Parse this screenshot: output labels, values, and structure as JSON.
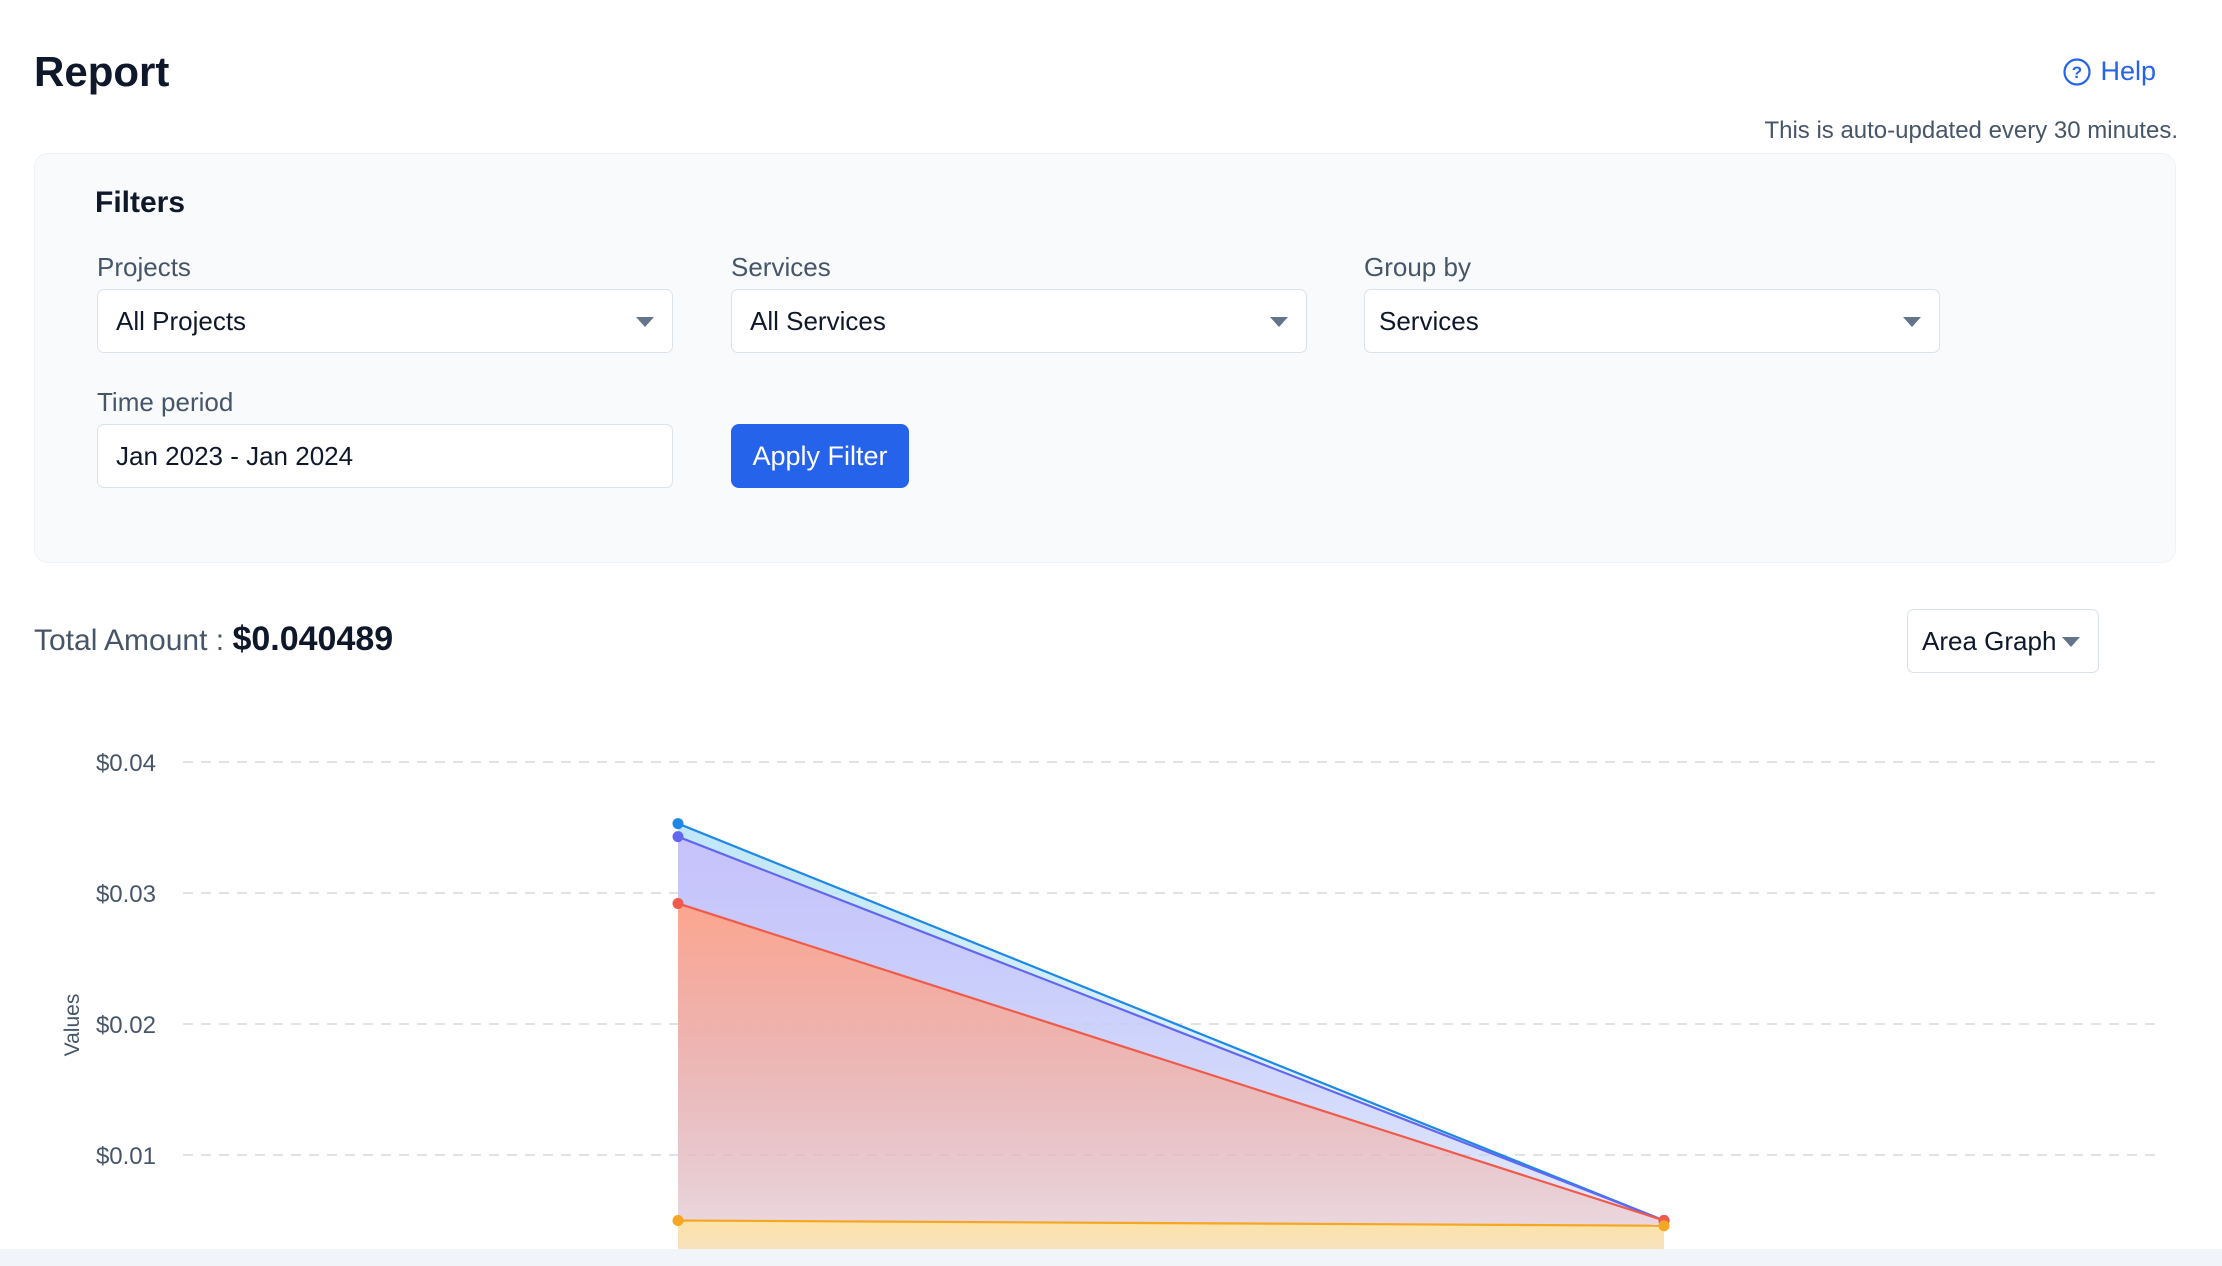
{
  "header": {
    "title": "Report",
    "help_label": "Help",
    "auto_update_note": "This is auto-updated every 30 minutes."
  },
  "filters": {
    "title": "Filters",
    "projects": {
      "label": "Projects",
      "value": "All Projects"
    },
    "services": {
      "label": "Services",
      "value": "All Services"
    },
    "group_by": {
      "label": "Group by",
      "value": "Services"
    },
    "time_period": {
      "label": "Time period",
      "value": "Jan 2023 - Jan 2024"
    },
    "apply_label": "Apply Filter"
  },
  "summary": {
    "total_label": "Total Amount : ",
    "total_value": "$0.040489",
    "chart_type": "Area Graph"
  },
  "chart_data": {
    "type": "area",
    "stacked": false,
    "ylabel": "Values",
    "yticks": [
      "$0.04",
      "$0.03",
      "$0.02",
      "$0.01"
    ],
    "ylim": [
      0,
      0.04
    ],
    "grid": true,
    "x_points": 2,
    "series": [
      {
        "values": [
          0.0353,
          0.005
        ],
        "color": "#1e88e5",
        "fill": "#bfe6f8"
      },
      {
        "values": [
          0.0343,
          0.005
        ],
        "color": "#6366f1",
        "fill": "#c7c2fb"
      },
      {
        "values": [
          0.0292,
          0.005
        ],
        "color": "#f05a4a",
        "fill": "#fca68f"
      },
      {
        "values": [
          0.005,
          0.0046
        ],
        "color": "#f5a623",
        "fill": "#fde4a8"
      }
    ]
  }
}
